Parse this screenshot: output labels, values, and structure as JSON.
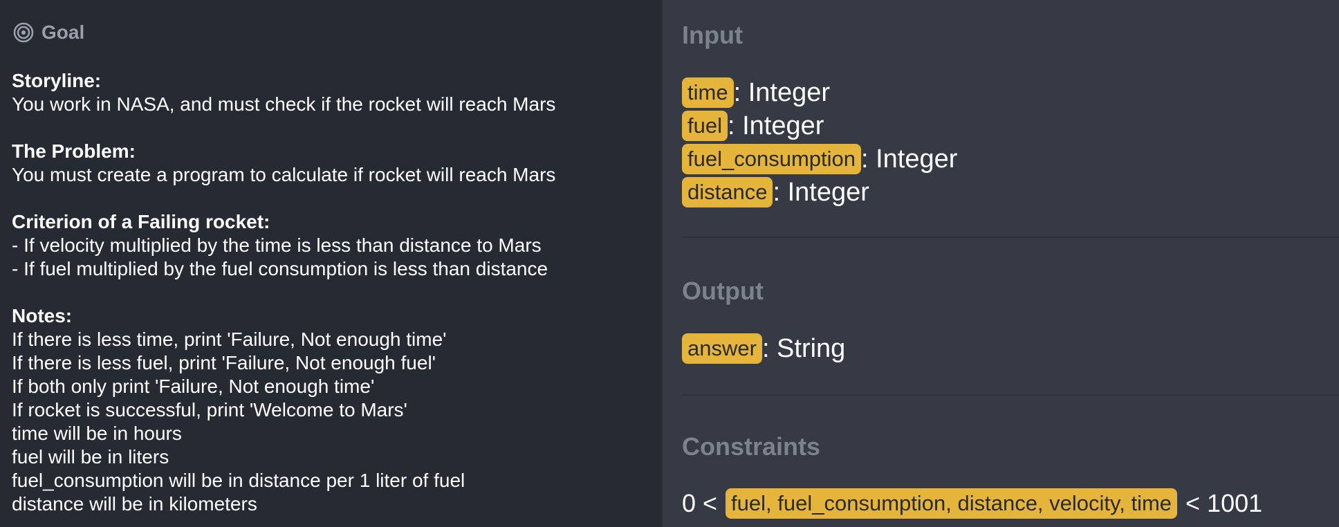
{
  "goal": {
    "title": "Goal",
    "sections": [
      {
        "heading": "Storyline:",
        "lines": [
          "You work in NASA, and must check if the rocket will reach Mars"
        ]
      },
      {
        "heading": "The Problem:",
        "lines": [
          "You must create a program to calculate if rocket will reach Mars"
        ]
      },
      {
        "heading": "Criterion of a Failing rocket:",
        "lines": [
          "- If velocity multiplied by the time is less than distance to Mars",
          "- If fuel multiplied by the fuel consumption is less than distance"
        ]
      },
      {
        "heading": "Notes:",
        "lines": [
          "If there is less time, print 'Failure, Not enough time'",
          "If there is less fuel, print 'Failure, Not enough fuel'",
          "If both only print 'Failure, Not enough time'",
          "If rocket is successful, print 'Welcome to Mars'",
          "time will be in hours",
          "fuel will be in liters",
          "fuel_consumption will be in distance per 1 liter of fuel",
          "distance will be in kilometers"
        ]
      }
    ]
  },
  "input": {
    "title": "Input",
    "params": [
      {
        "name": "time",
        "type": ": Integer"
      },
      {
        "name": "fuel",
        "type": ": Integer"
      },
      {
        "name": "fuel_consumption",
        "type": ": Integer"
      },
      {
        "name": "distance",
        "type": ": Integer"
      }
    ]
  },
  "output": {
    "title": "Output",
    "params": [
      {
        "name": "answer",
        "type": ": String"
      }
    ]
  },
  "constraints": {
    "title": "Constraints",
    "prefix": "0 <",
    "vars": "fuel, fuel_consumption, distance, velocity, time",
    "suffix": "< 1001"
  },
  "colors": {
    "left_bg": "#252a33",
    "right_bg": "#353a44",
    "tag_bg": "#e5b43a",
    "muted_title": "#7d838c"
  },
  "icons": {
    "goal": "target-icon"
  }
}
